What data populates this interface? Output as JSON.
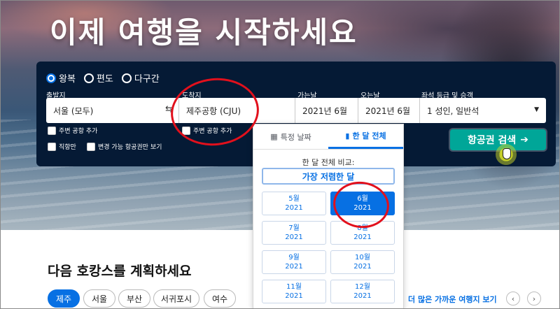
{
  "hero": {
    "title": "이제 여행을 시작하세요"
  },
  "trip_types": [
    {
      "label": "왕복",
      "selected": true
    },
    {
      "label": "편도",
      "selected": false
    },
    {
      "label": "다구간",
      "selected": false
    }
  ],
  "fields": {
    "from": {
      "label": "출발지",
      "value": "서울 (모두)"
    },
    "to": {
      "label": "도착지",
      "value": "제주공항 (CJU)"
    },
    "depart": {
      "label": "가는날",
      "value": "2021년 6월"
    },
    "return": {
      "label": "오는날",
      "value": "2021년 6월"
    },
    "cabin": {
      "label": "좌석 등급 및 승객",
      "value": "1 성인, 일반석"
    }
  },
  "checkboxes": {
    "nearby_from": "주변 공항 추가",
    "nearby_to": "주변 공항 추가",
    "direct_only": "직항만",
    "flexible_tickets": "변경 가능 항공권만 보기"
  },
  "search_button": {
    "label": "항공권 검색",
    "arrow": "➔"
  },
  "calendar": {
    "tabs": [
      {
        "icon": "calendar-icon",
        "label": "특정 날짜",
        "active": false
      },
      {
        "icon": "bar-chart-icon",
        "label": "한 달 전체",
        "active": true
      }
    ],
    "subtitle": "한 달 전체 비교:",
    "cheapest_label": "가장 저렴한 달",
    "months": [
      {
        "month": "5월",
        "year": "2021",
        "selected": false
      },
      {
        "month": "6월",
        "year": "2021",
        "selected": true
      },
      {
        "month": "7월",
        "year": "2021",
        "selected": false
      },
      {
        "month": "8월",
        "year": "2021",
        "selected": false
      },
      {
        "month": "9월",
        "year": "2021",
        "selected": false
      },
      {
        "month": "10월",
        "year": "2021",
        "selected": false
      },
      {
        "month": "11월",
        "year": "2021",
        "selected": false
      },
      {
        "month": "12월",
        "year": "2021",
        "selected": false
      }
    ]
  },
  "lower": {
    "title": "다음 호캉스를 계획하세요",
    "chips": [
      "제주",
      "서울",
      "부산",
      "서귀포시",
      "여수"
    ],
    "more_link": "더 많은 가까운 여행지 보기",
    "prev_icon": "‹",
    "next_icon": "›"
  },
  "colors": {
    "panel": "#051a35",
    "accent": "#0770e3",
    "search_button": "#00a698",
    "annotation": "#e2101c"
  }
}
